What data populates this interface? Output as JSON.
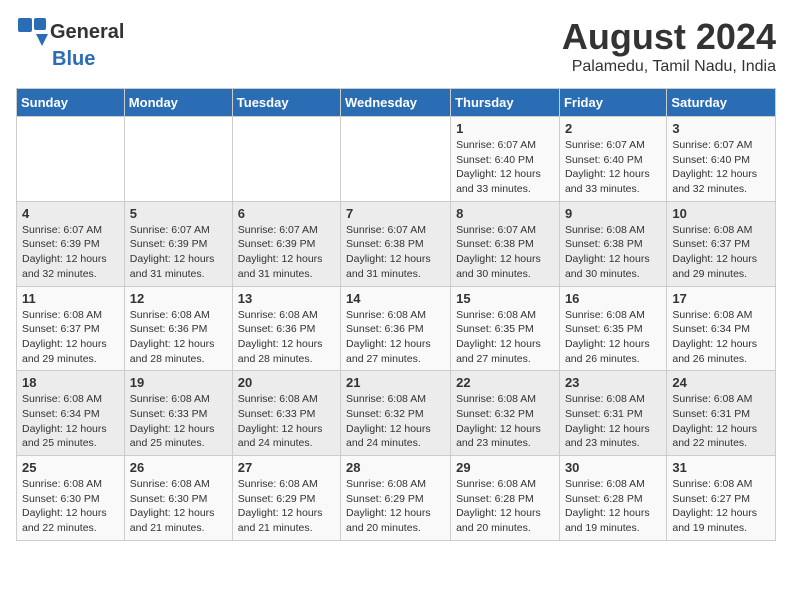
{
  "header": {
    "logo_general": "General",
    "logo_blue": "Blue",
    "month_year": "August 2024",
    "location": "Palamedu, Tamil Nadu, India"
  },
  "weekdays": [
    "Sunday",
    "Monday",
    "Tuesday",
    "Wednesday",
    "Thursday",
    "Friday",
    "Saturday"
  ],
  "weeks": [
    [
      {
        "day": "",
        "info": ""
      },
      {
        "day": "",
        "info": ""
      },
      {
        "day": "",
        "info": ""
      },
      {
        "day": "",
        "info": ""
      },
      {
        "day": "1",
        "info": "Sunrise: 6:07 AM\nSunset: 6:40 PM\nDaylight: 12 hours\nand 33 minutes."
      },
      {
        "day": "2",
        "info": "Sunrise: 6:07 AM\nSunset: 6:40 PM\nDaylight: 12 hours\nand 33 minutes."
      },
      {
        "day": "3",
        "info": "Sunrise: 6:07 AM\nSunset: 6:40 PM\nDaylight: 12 hours\nand 32 minutes."
      }
    ],
    [
      {
        "day": "4",
        "info": "Sunrise: 6:07 AM\nSunset: 6:39 PM\nDaylight: 12 hours\nand 32 minutes."
      },
      {
        "day": "5",
        "info": "Sunrise: 6:07 AM\nSunset: 6:39 PM\nDaylight: 12 hours\nand 31 minutes."
      },
      {
        "day": "6",
        "info": "Sunrise: 6:07 AM\nSunset: 6:39 PM\nDaylight: 12 hours\nand 31 minutes."
      },
      {
        "day": "7",
        "info": "Sunrise: 6:07 AM\nSunset: 6:38 PM\nDaylight: 12 hours\nand 31 minutes."
      },
      {
        "day": "8",
        "info": "Sunrise: 6:07 AM\nSunset: 6:38 PM\nDaylight: 12 hours\nand 30 minutes."
      },
      {
        "day": "9",
        "info": "Sunrise: 6:08 AM\nSunset: 6:38 PM\nDaylight: 12 hours\nand 30 minutes."
      },
      {
        "day": "10",
        "info": "Sunrise: 6:08 AM\nSunset: 6:37 PM\nDaylight: 12 hours\nand 29 minutes."
      }
    ],
    [
      {
        "day": "11",
        "info": "Sunrise: 6:08 AM\nSunset: 6:37 PM\nDaylight: 12 hours\nand 29 minutes."
      },
      {
        "day": "12",
        "info": "Sunrise: 6:08 AM\nSunset: 6:36 PM\nDaylight: 12 hours\nand 28 minutes."
      },
      {
        "day": "13",
        "info": "Sunrise: 6:08 AM\nSunset: 6:36 PM\nDaylight: 12 hours\nand 28 minutes."
      },
      {
        "day": "14",
        "info": "Sunrise: 6:08 AM\nSunset: 6:36 PM\nDaylight: 12 hours\nand 27 minutes."
      },
      {
        "day": "15",
        "info": "Sunrise: 6:08 AM\nSunset: 6:35 PM\nDaylight: 12 hours\nand 27 minutes."
      },
      {
        "day": "16",
        "info": "Sunrise: 6:08 AM\nSunset: 6:35 PM\nDaylight: 12 hours\nand 26 minutes."
      },
      {
        "day": "17",
        "info": "Sunrise: 6:08 AM\nSunset: 6:34 PM\nDaylight: 12 hours\nand 26 minutes."
      }
    ],
    [
      {
        "day": "18",
        "info": "Sunrise: 6:08 AM\nSunset: 6:34 PM\nDaylight: 12 hours\nand 25 minutes."
      },
      {
        "day": "19",
        "info": "Sunrise: 6:08 AM\nSunset: 6:33 PM\nDaylight: 12 hours\nand 25 minutes."
      },
      {
        "day": "20",
        "info": "Sunrise: 6:08 AM\nSunset: 6:33 PM\nDaylight: 12 hours\nand 24 minutes."
      },
      {
        "day": "21",
        "info": "Sunrise: 6:08 AM\nSunset: 6:32 PM\nDaylight: 12 hours\nand 24 minutes."
      },
      {
        "day": "22",
        "info": "Sunrise: 6:08 AM\nSunset: 6:32 PM\nDaylight: 12 hours\nand 23 minutes."
      },
      {
        "day": "23",
        "info": "Sunrise: 6:08 AM\nSunset: 6:31 PM\nDaylight: 12 hours\nand 23 minutes."
      },
      {
        "day": "24",
        "info": "Sunrise: 6:08 AM\nSunset: 6:31 PM\nDaylight: 12 hours\nand 22 minutes."
      }
    ],
    [
      {
        "day": "25",
        "info": "Sunrise: 6:08 AM\nSunset: 6:30 PM\nDaylight: 12 hours\nand 22 minutes."
      },
      {
        "day": "26",
        "info": "Sunrise: 6:08 AM\nSunset: 6:30 PM\nDaylight: 12 hours\nand 21 minutes."
      },
      {
        "day": "27",
        "info": "Sunrise: 6:08 AM\nSunset: 6:29 PM\nDaylight: 12 hours\nand 21 minutes."
      },
      {
        "day": "28",
        "info": "Sunrise: 6:08 AM\nSunset: 6:29 PM\nDaylight: 12 hours\nand 20 minutes."
      },
      {
        "day": "29",
        "info": "Sunrise: 6:08 AM\nSunset: 6:28 PM\nDaylight: 12 hours\nand 20 minutes."
      },
      {
        "day": "30",
        "info": "Sunrise: 6:08 AM\nSunset: 6:28 PM\nDaylight: 12 hours\nand 19 minutes."
      },
      {
        "day": "31",
        "info": "Sunrise: 6:08 AM\nSunset: 6:27 PM\nDaylight: 12 hours\nand 19 minutes."
      }
    ]
  ]
}
